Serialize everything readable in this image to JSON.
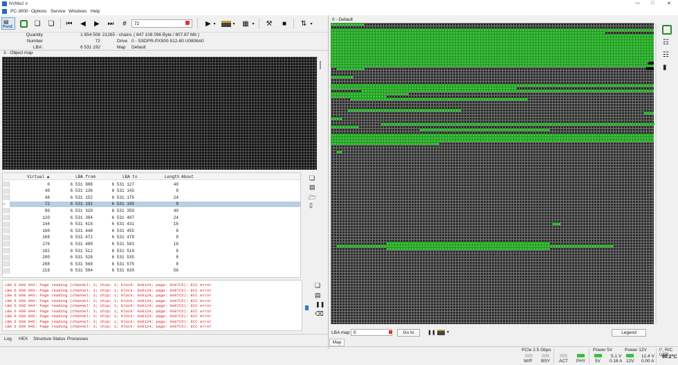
{
  "window": {
    "title": "NVMe2 #"
  },
  "menu": [
    "PC-3000",
    "Options",
    "Service",
    "Windows",
    "Help"
  ],
  "toolbar": {
    "port_label": "Port2",
    "lba_value": "72"
  },
  "info": {
    "quantity_label": "Quantity",
    "quantity_value": "1 654 508",
    "chains_text": "21265 - chains",
    "bytes_text": "( 847 108 096 Byte / 807.87 Mb )",
    "number_label": "Number",
    "number_value": "72",
    "drive_label": "Drive",
    "drive_value": "0 - SSDPR-PX500-512-80 U0806A0",
    "lba_label": "LBA:",
    "lba_value": "6 531 192",
    "map_label": "Map",
    "map_value": "Default"
  },
  "object_map": {
    "title": "3 - Object map"
  },
  "table": {
    "columns": [
      "Virtual ▲",
      "LBA from",
      "LBA to",
      "Length",
      "About"
    ],
    "rows": [
      [
        "0",
        "6 531 088",
        "6 531 127",
        "40",
        ""
      ],
      [
        "40",
        "6 531 136",
        "6 531 143",
        "8",
        ""
      ],
      [
        "48",
        "6 531 152",
        "6 531 175",
        "24",
        ""
      ],
      [
        "72",
        "6 531 192",
        "6 531 199",
        "8",
        ""
      ],
      [
        "80",
        "6 531 320",
        "6 531 359",
        "40",
        ""
      ],
      [
        "120",
        "6 531 384",
        "6 531 407",
        "24",
        ""
      ],
      [
        "144",
        "6 531 416",
        "6 531 431",
        "16",
        ""
      ],
      [
        "160",
        "6 531 448",
        "6 531 455",
        "8",
        ""
      ],
      [
        "168",
        "6 531 472",
        "6 531 479",
        "8",
        ""
      ],
      [
        "176",
        "6 531 488",
        "6 531 503",
        "16",
        ""
      ],
      [
        "192",
        "6 531 512",
        "6 531 519",
        "8",
        ""
      ],
      [
        "200",
        "6 531 528",
        "6 531 535",
        "8",
        ""
      ],
      [
        "208",
        "6 531 568",
        "6 531 575",
        "8",
        ""
      ],
      [
        "216",
        "6 531 584",
        "6 531 639",
        "56",
        ""
      ]
    ],
    "selected_row": 3
  },
  "log": {
    "lines": [
      "LBA 6 660 043: Page reading (channel: 3; chip: 1; block: 0x0124; page: 0x07C5): ECC error",
      "LBA 6 660 043: Page reading (channel: 3; chip: 1; block: 0x0124; page: 0x07C5): ECC error",
      "LBA 6 660 043: Page reading (channel: 3; chip: 1; block: 0x0124; page: 0x07C5): ECC error",
      "LBA 6 660 044: Page reading (channel: 3; chip: 1; block: 0x0124; page: 0x07C5): ECC error",
      "LBA 6 660 044: Page reading (channel: 3; chip: 1; block: 0x0124; page: 0x07C5): ECC error",
      "LBA 6 660 044: Page reading (channel: 3; chip: 1; block: 0x0124; page: 0x07C5): ECC error",
      "LBA 6 660 045: Page reading (channel: 3; chip: 1; block: 0x0124; page: 0x07C5): ECC error",
      "LBA 6 660 045: Page reading (channel: 3; chip: 1; block: 0x0124; page: 0x07C5): ECC error",
      "LBA 6 660 045: Page reading (channel: 3; chip: 1; block: 0x0124; page: 0x07C5): ECC error"
    ]
  },
  "bottom_tabs": [
    "Log",
    "HEX",
    "Structure",
    "Status",
    "Processes"
  ],
  "map": {
    "title": "0 - Default",
    "lba_map_label": "LBA map",
    "lba_map_value": "0",
    "goto_label": "Go to",
    "legend_label": "Legend",
    "tab_label": "Map"
  },
  "status": {
    "pcie": "PCIe 2.5 Gbps",
    "wp": "W/P",
    "bsy": "BSY",
    "act": "ACT",
    "phy": "PHY",
    "power5_label": "Power 5V",
    "v5": "5V",
    "v5_volt": "5.1 V",
    "v5_amp": "0.18 A",
    "power12_label": "Power 12V",
    "v12": "12V",
    "v12_volt": "12.4 V",
    "v12_amp": "0.00 A",
    "temp_label": "t°, R/C USB",
    "temp_value": "60.2°C"
  },
  "colors": {
    "good": "#3cbf3c",
    "error_text": "#d42020",
    "selected_row": "#b8cfe4"
  }
}
